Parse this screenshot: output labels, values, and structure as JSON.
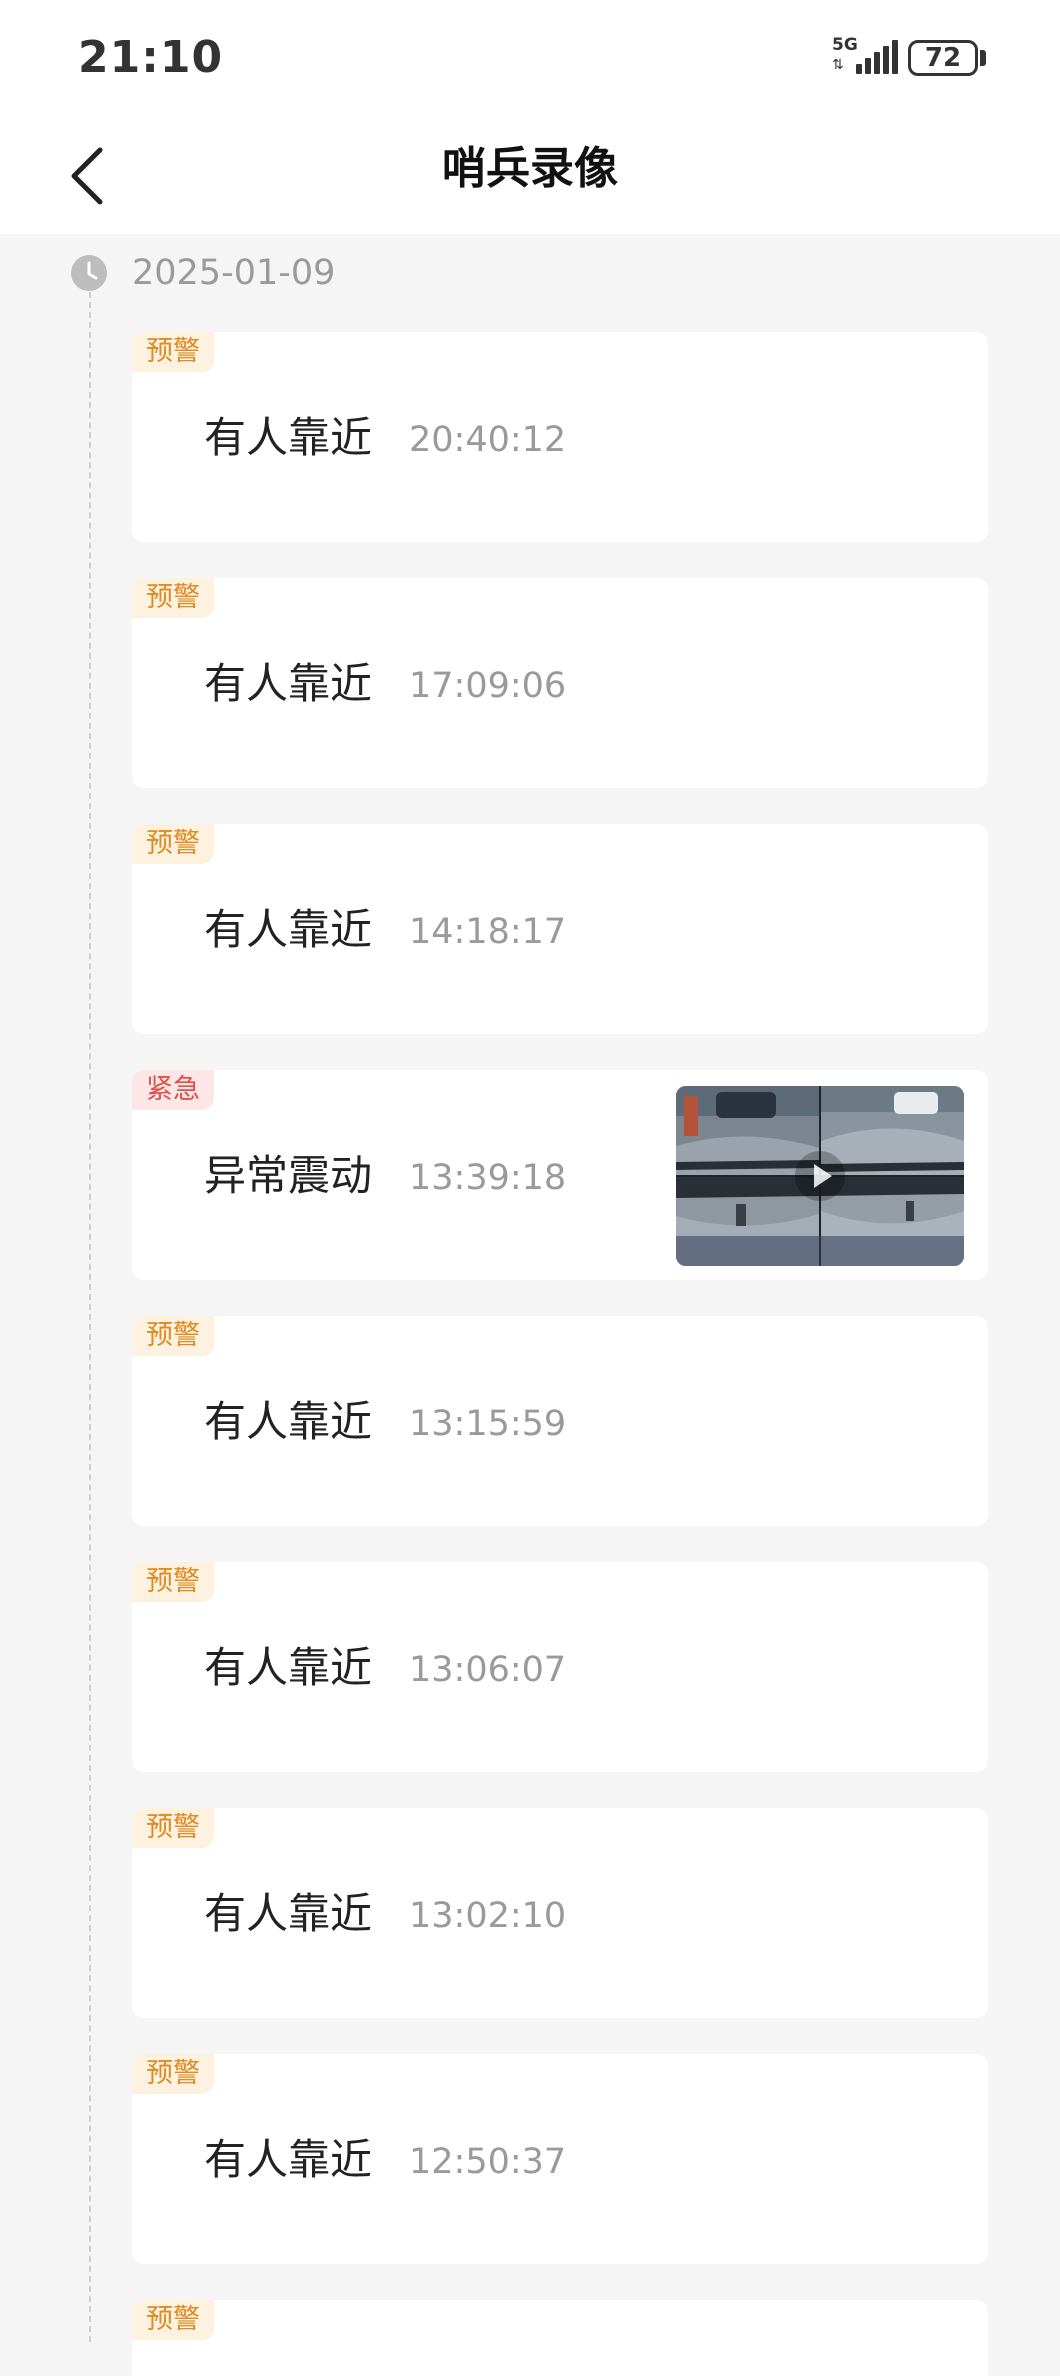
{
  "status_bar": {
    "time": "21:10",
    "network": "5G",
    "battery": "72"
  },
  "header": {
    "title": "哨兵录像",
    "back_icon": "chevron-left-icon"
  },
  "timeline": {
    "date": "2025-01-09",
    "icon": "clock-icon"
  },
  "colors": {
    "warn_tag_bg": "#fdf1e0",
    "warn_tag_text": "#e08a22",
    "urgent_tag_bg": "#fde7e6",
    "urgent_tag_text": "#e1504c"
  },
  "events": [
    {
      "tag": "预警",
      "level": "warn",
      "title": "有人靠近",
      "time": "20:40:12",
      "thumbnail": false
    },
    {
      "tag": "预警",
      "level": "warn",
      "title": "有人靠近",
      "time": "17:09:06",
      "thumbnail": false
    },
    {
      "tag": "预警",
      "level": "warn",
      "title": "有人靠近",
      "time": "14:18:17",
      "thumbnail": false
    },
    {
      "tag": "紧急",
      "level": "urgent",
      "title": "异常震动",
      "time": "13:39:18",
      "thumbnail": true
    },
    {
      "tag": "预警",
      "level": "warn",
      "title": "有人靠近",
      "time": "13:15:59",
      "thumbnail": false
    },
    {
      "tag": "预警",
      "level": "warn",
      "title": "有人靠近",
      "time": "13:06:07",
      "thumbnail": false
    },
    {
      "tag": "预警",
      "level": "warn",
      "title": "有人靠近",
      "time": "13:02:10",
      "thumbnail": false
    },
    {
      "tag": "预警",
      "level": "warn",
      "title": "有人靠近",
      "time": "12:50:37",
      "thumbnail": false
    },
    {
      "tag": "预警",
      "level": "warn",
      "title": "",
      "time": "",
      "thumbnail": false
    }
  ]
}
